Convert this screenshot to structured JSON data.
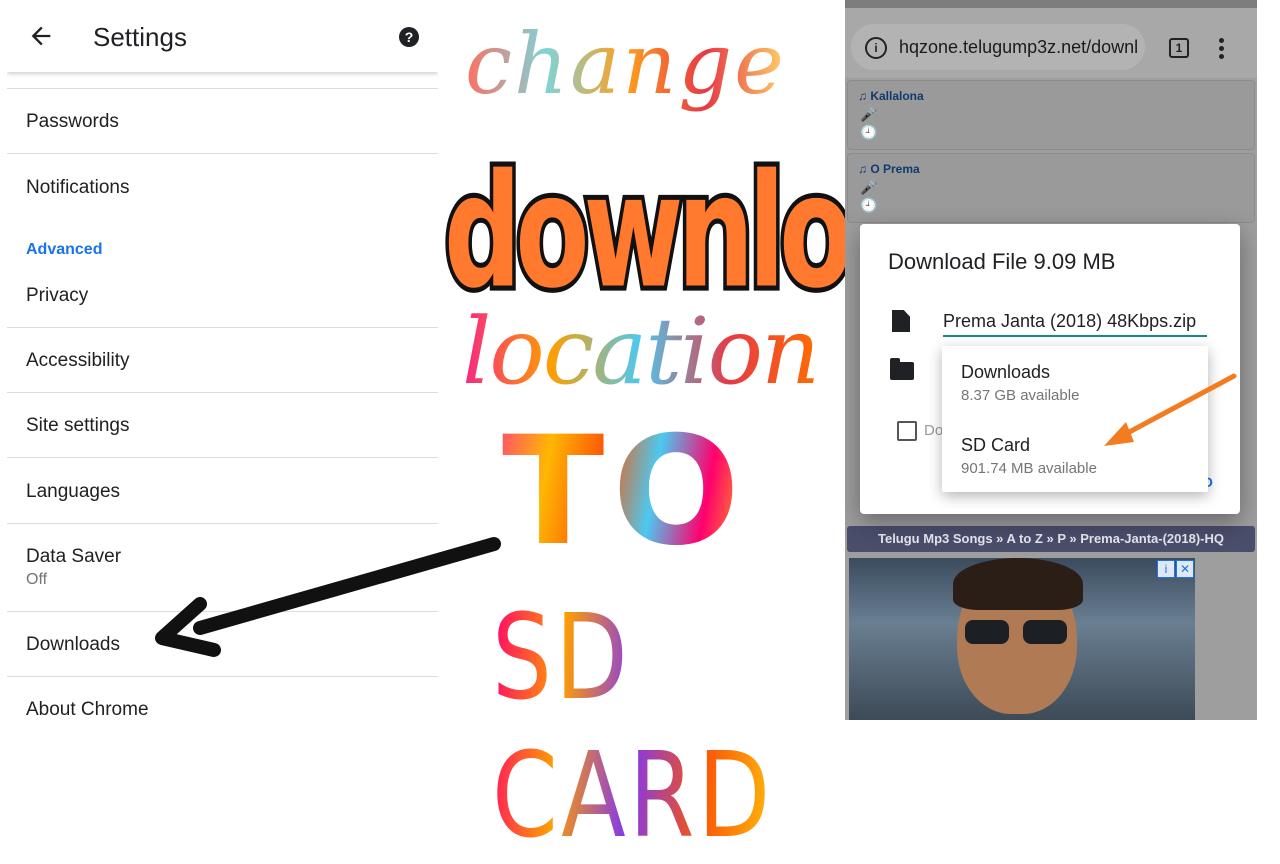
{
  "settings": {
    "title": "Settings",
    "help_glyph": "?",
    "items": [
      {
        "label": "Passwords"
      },
      {
        "label": "Notifications"
      },
      {
        "label": "Privacy"
      },
      {
        "label": "Accessibility"
      },
      {
        "label": "Site settings"
      },
      {
        "label": "Languages"
      },
      {
        "label": "Data Saver",
        "sub": "Off"
      },
      {
        "label": "Downloads"
      },
      {
        "label": "About Chrome"
      }
    ],
    "section_advanced": "Advanced"
  },
  "overlay_text": {
    "line1": "change",
    "line2": "download",
    "line3": "location",
    "line4": "TO",
    "line5": "SD CARD"
  },
  "browser": {
    "url": "hqzone.telugump3z.net/downl",
    "tab_count": "1",
    "songs": [
      {
        "name": "♫ Kallalona"
      },
      {
        "name": "♫ O Prema"
      }
    ],
    "breadcrumb": "Telugu Mp3 Songs » A to Z » P » Prema-Janta-(2018)-HQ",
    "ad_info_glyph": "i",
    "ad_close_glyph": "✕"
  },
  "dialog": {
    "title": "Download File 9.09 MB",
    "filename": "Prema Janta (2018) 48Kbps.zip",
    "checkbox_partial": "Do",
    "button_partial": "O",
    "options": [
      {
        "title": "Downloads",
        "sub": "8.37 GB available"
      },
      {
        "title": "SD Card",
        "sub": "901.74 MB available"
      }
    ]
  },
  "colors": {
    "accent_blue": "#1a73e8",
    "input_underline": "#138a8a",
    "arrow_orange": "#f47c20",
    "arrow_black": "#111111"
  }
}
